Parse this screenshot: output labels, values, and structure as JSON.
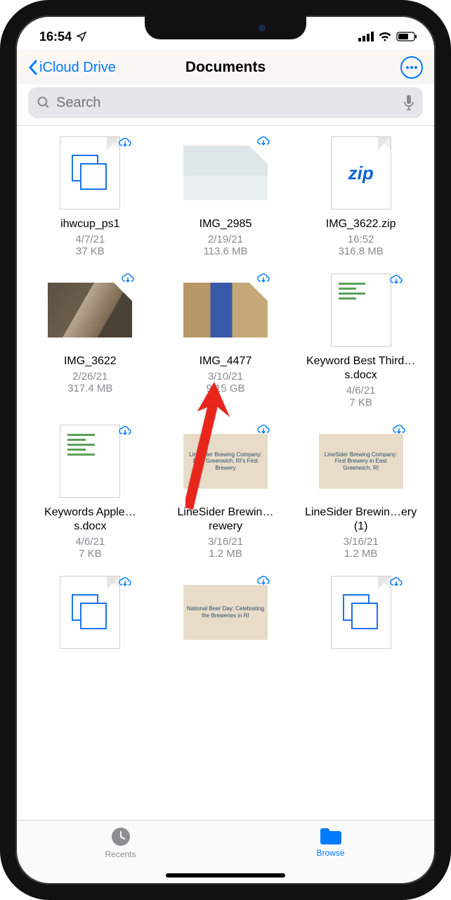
{
  "status": {
    "time": "16:54"
  },
  "nav": {
    "back": "iCloud Drive",
    "title": "Documents"
  },
  "search": {
    "placeholder": "Search"
  },
  "files": [
    {
      "name": "ihwcup_ps1",
      "date": "4/7/21",
      "size": "37 KB"
    },
    {
      "name": "IMG_2985",
      "date": "2/19/21",
      "size": "113.6 MB"
    },
    {
      "name": "IMG_3622.zip",
      "date": "16:52",
      "size": "316.8 MB"
    },
    {
      "name": "IMG_3622",
      "date": "2/26/21",
      "size": "317.4 MB"
    },
    {
      "name": "IMG_4477",
      "date": "3/10/21",
      "size": "9.15 GB"
    },
    {
      "name": "Keyword Best Third…s.docx",
      "date": "4/6/21",
      "size": "7 KB"
    },
    {
      "name": "Keywords Apple…s.docx",
      "date": "4/6/21",
      "size": "7 KB"
    },
    {
      "name": "LineSider Brewin…rewery",
      "date": "3/16/21",
      "size": "1.2 MB"
    },
    {
      "name": "LineSider Brewin…ery (1)",
      "date": "3/16/21",
      "size": "1.2 MB"
    }
  ],
  "brewery_text1": "LineSider Brewing Company: East Greenwich, RI's First Brewery",
  "brewery_text2": "LineSider Brewing Company: First Brewery in East Greenwich, RI",
  "brewery_text3": "National Beer Day: Celebrating the Breweries in RI",
  "tabs": {
    "recents": "Recents",
    "browse": "Browse"
  },
  "zip_label": "zip"
}
